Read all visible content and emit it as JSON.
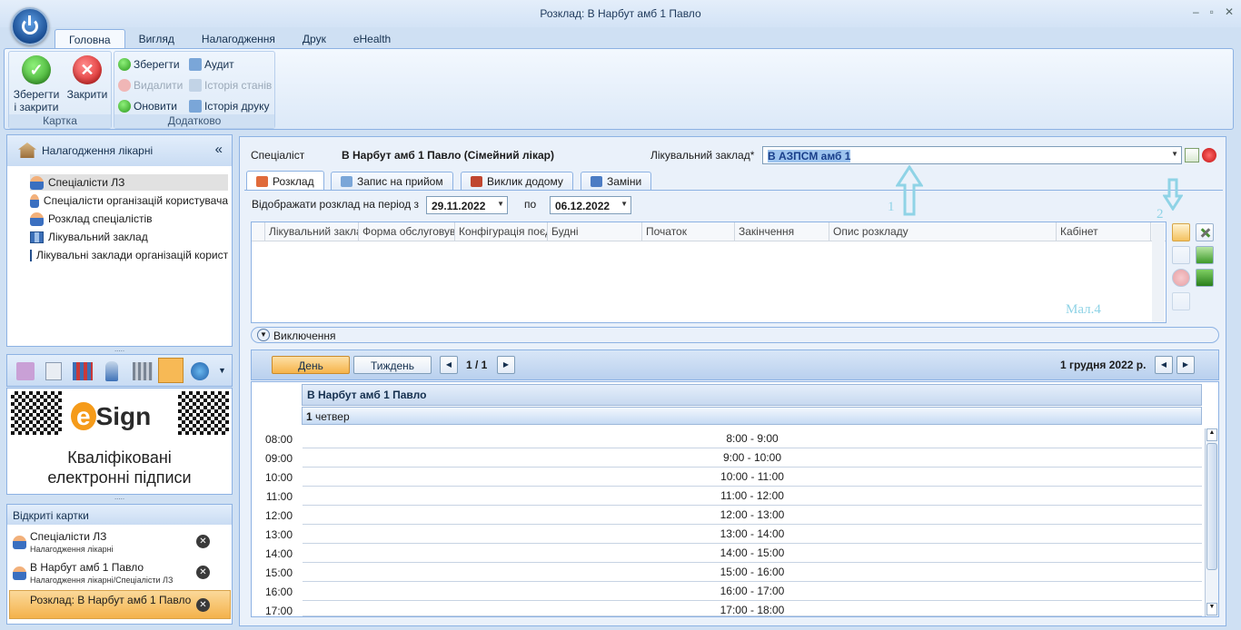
{
  "window": {
    "title": "Розклад: В Нарбут амб 1 Павло",
    "controls": [
      "–",
      "▫",
      "✕"
    ]
  },
  "ribbon": {
    "tabs": [
      "Головна",
      "Вигляд",
      "Налагодження",
      "Друк",
      "eHealth"
    ],
    "active_tab": "Головна",
    "groups": {
      "card": {
        "label": "Картка",
        "save_close": "Зберегти і закрити",
        "close": "Закрити"
      },
      "extra": {
        "label": "Додатково",
        "save": "Зберегти",
        "delete": "Видалити",
        "refresh": "Оновити",
        "audit": "Аудит",
        "state_history": "Історія станів",
        "print_history": "Історія друку"
      }
    }
  },
  "sidebar": {
    "header": "Налагодження лікарні",
    "collapse": "«",
    "items": [
      {
        "label": "Спеціалісти ЛЗ",
        "icon": "person-icon",
        "selected": true
      },
      {
        "label": "Спеціалісти організацій користувача",
        "icon": "person-icon"
      },
      {
        "label": "Розклад спеціалістів",
        "icon": "person-icon"
      },
      {
        "label": "Лікувальний заклад",
        "icon": "building-icon"
      },
      {
        "label": "Лікувальні заклади організацій користувача",
        "icon": "building-icon"
      }
    ],
    "splitter": ".....",
    "banner": {
      "brand_e": "e",
      "brand_rest": "Sign",
      "line1": "Кваліфіковані",
      "line2": "електронні підписи"
    },
    "open_cards": {
      "header": "Відкриті картки",
      "items": [
        {
          "title": "Спеціалісти ЛЗ",
          "path": "Налагодження лікарні"
        },
        {
          "title": "В Нарбут амб 1 Павло",
          "path": "Налагодження лікарні/Спеціалісти ЛЗ"
        },
        {
          "title": "Розклад: В Нарбут амб 1 Павло",
          "path": "",
          "active": true
        }
      ]
    }
  },
  "main": {
    "specialist_label": "Спеціаліст",
    "specialist_value": "В Нарбут амб 1 Павло (Сімейний лікар)",
    "facility_label": "Лікувальний заклад*",
    "facility_value": "В АЗПСМ амб 1",
    "tabs": [
      "Розклад",
      "Запис на прийом",
      "Виклик додому",
      "Заміни"
    ],
    "active_tab": "Розклад",
    "period_label": "Відображати розклад на період з",
    "date_from": "29.11.2022",
    "to_label": "по",
    "date_to": "06.12.2022",
    "columns": [
      "Лікувальний заклад",
      "Форма обслуговування",
      "Конфігурація поєднання",
      "Будні",
      "Початок",
      "Закінчення",
      "Опис розкладу",
      "Кабінет"
    ],
    "annotation_1": "1",
    "annotation_2": "2",
    "annotation_fig": "Мал.4",
    "exclusions_label": "Виключення",
    "view_day": "День",
    "view_week": "Тиждень",
    "pager": "1 / 1",
    "current_date": "1 грудня 2022 р.",
    "calendar": {
      "resource": "В Нарбут амб 1 Павло",
      "day_num": "1",
      "day_name": "четвер",
      "hours": [
        "08:00",
        "09:00",
        "10:00",
        "11:00",
        "12:00",
        "13:00",
        "14:00",
        "15:00",
        "16:00",
        "17:00"
      ],
      "slots": [
        "8:00 - 9:00",
        "9:00 - 10:00",
        "10:00 - 11:00",
        "11:00 - 12:00",
        "12:00 - 13:00",
        "13:00 - 14:00",
        "14:00 - 15:00",
        "15:00 - 16:00",
        "16:00 - 17:00",
        "17:00 - 18:00"
      ]
    }
  },
  "colors": {
    "accent": "#f7b955",
    "frame": "#8db2e3",
    "annotation": "#8fd3e6"
  }
}
